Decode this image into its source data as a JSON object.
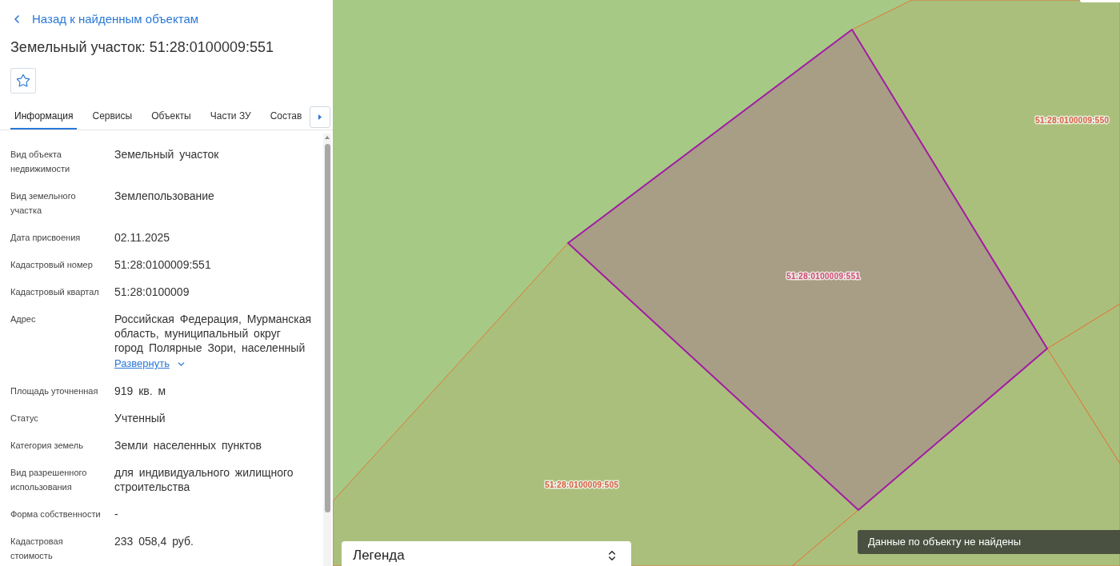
{
  "back_link": {
    "label": "Назад к найденным объектам"
  },
  "title": "Земельный участок: 51:28:0100009:551",
  "favorite": {
    "checked": false
  },
  "tabs": [
    {
      "label": "Информация",
      "selected": true
    },
    {
      "label": "Сервисы",
      "selected": false
    },
    {
      "label": "Объекты",
      "selected": false
    },
    {
      "label": "Части ЗУ",
      "selected": false
    },
    {
      "label": "Состав",
      "selected": false
    }
  ],
  "fields": [
    {
      "label": "Вид объекта недвижимости",
      "value": "Земельный участок"
    },
    {
      "label": "Вид земельного участка",
      "value": "Землепользование"
    },
    {
      "label": "Дата присвоения",
      "value": "02.11.2025"
    },
    {
      "label": "Кадастровый номер",
      "value": "51:28:0100009:551"
    },
    {
      "label": "Кадастровый квартал",
      "value": "51:28:0100009"
    },
    {
      "label": "Адрес",
      "value": "Российская Федерация, Мурманская область, муниципальный округ город Полярные Зори, населенный",
      "expand_link": "Развернуть"
    },
    {
      "label": "Площадь уточненная",
      "value": "919 кв. м"
    },
    {
      "label": "Статус",
      "value": "Учтенный"
    },
    {
      "label": "Категория земель",
      "value": "Земли населенных пунктов"
    },
    {
      "label": "Вид разрешенного использования",
      "value": "для индивидуального жилищного строительства"
    },
    {
      "label": "Форма собственности",
      "value": "-"
    },
    {
      "label": "Кадастровая стоимость",
      "value": "233 058,4 руб."
    }
  ],
  "map": {
    "parcels": [
      {
        "label": "51:28:0100009:550",
        "selected": false
      },
      {
        "label": "51:28:0100009:551",
        "selected": true
      },
      {
        "label": "51:28:0100009:505",
        "selected": false
      }
    ]
  },
  "legend": {
    "title": "Легенда"
  },
  "toast": {
    "message": "Данные по объекту не найдены"
  }
}
